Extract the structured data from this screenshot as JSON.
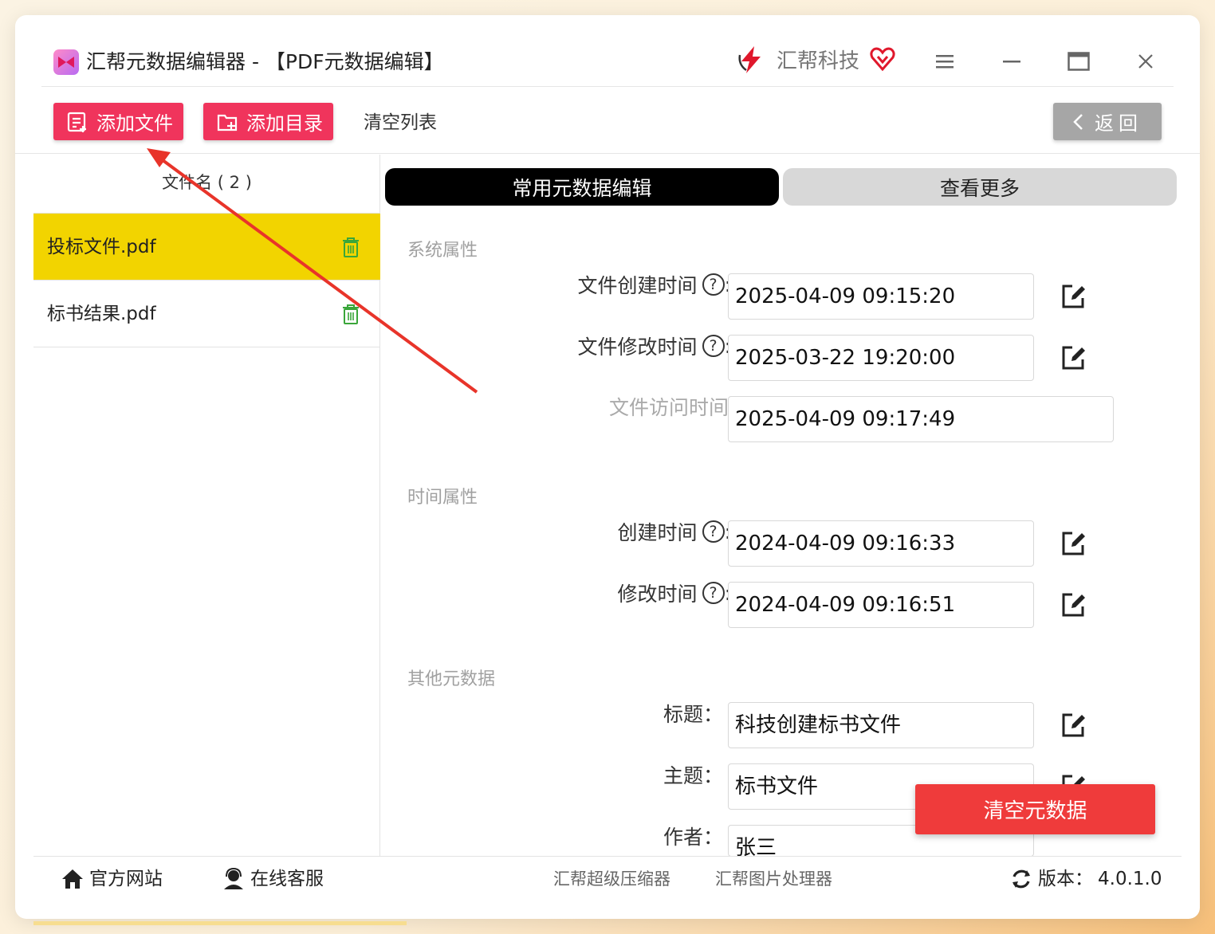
{
  "window": {
    "title": "汇帮元数据编辑器 - 【PDF元数据编辑】",
    "brand_name": "汇帮科技"
  },
  "toolbar": {
    "add_file_label": "添加文件",
    "add_dir_label": "添加目录",
    "clear_list_label": "清空列表",
    "back_label": "返回"
  },
  "file_list": {
    "header": "文件名 ( 2 )",
    "items": [
      {
        "name": "投标文件.pdf",
        "selected": true
      },
      {
        "name": "标书结果.pdf",
        "selected": false
      }
    ]
  },
  "tabs": {
    "common": "常用元数据编辑",
    "more": "查看更多"
  },
  "sections": {
    "system": {
      "title": "系统属性",
      "fields": [
        {
          "label": "文件创建时间",
          "value": "2025-04-09 09:15:20",
          "help": true,
          "editable": true
        },
        {
          "label": "文件修改时间",
          "value": "2025-03-22 19:20:00",
          "help": true,
          "editable": true
        },
        {
          "label": "文件访问时间",
          "value": "2025-04-09 09:17:49",
          "help": false,
          "editable": false
        }
      ]
    },
    "time": {
      "title": "时间属性",
      "fields": [
        {
          "label": "创建时间",
          "value": "2024-04-09 09:16:33",
          "help": true,
          "editable": true
        },
        {
          "label": "修改时间",
          "value": "2024-04-09 09:16:51",
          "help": true,
          "editable": true
        }
      ]
    },
    "other": {
      "title": "其他元数据",
      "fields": [
        {
          "label": "标题：",
          "value": "科技创建标书文件"
        },
        {
          "label": "主题：",
          "value": "标书文件"
        },
        {
          "label": "作者：",
          "value": "张三"
        }
      ]
    }
  },
  "help_glyph": "?",
  "label_colon": "：",
  "clear_metadata_label": "清空元数据",
  "footer": {
    "website": "官方网站",
    "support": "在线客服",
    "compressor": "汇帮超级压缩器",
    "image_tool": "汇帮图片处理器",
    "version_label": "版本：",
    "version": "4.0.1.0"
  },
  "colors": {
    "primary_pink": "#f0345c",
    "selected_row": "#f2d400",
    "clear_red": "#ef3b3b",
    "back_gray": "#a6a6a6",
    "annotation_arrow": "#e8342a"
  }
}
